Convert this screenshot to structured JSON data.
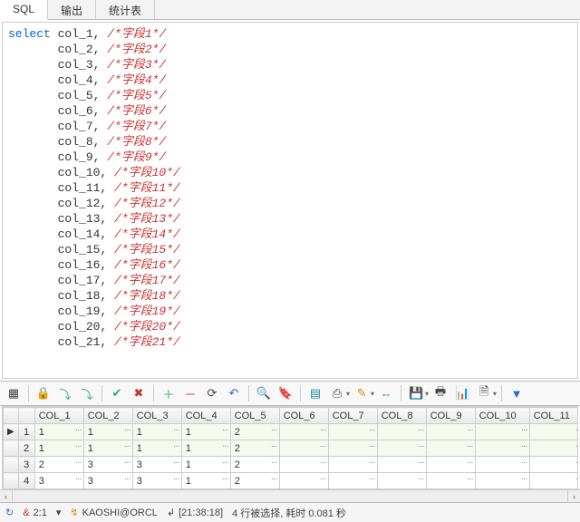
{
  "tabs": {
    "sql": "SQL",
    "output": "输出",
    "stats": "统计表"
  },
  "sql": {
    "keyword": "select",
    "lines": [
      {
        "col": "col_1,",
        "comment": "/*字段1*/"
      },
      {
        "col": "col_2,",
        "comment": "/*字段2*/"
      },
      {
        "col": "col_3,",
        "comment": "/*字段3*/"
      },
      {
        "col": "col_4,",
        "comment": "/*字段4*/"
      },
      {
        "col": "col_5,",
        "comment": "/*字段5*/"
      },
      {
        "col": "col_6,",
        "comment": "/*字段6*/"
      },
      {
        "col": "col_7,",
        "comment": "/*字段7*/"
      },
      {
        "col": "col_8,",
        "comment": "/*字段8*/"
      },
      {
        "col": "col_9,",
        "comment": "/*字段9*/"
      },
      {
        "col": "col_10,",
        "comment": "/*字段10*/"
      },
      {
        "col": "col_11,",
        "comment": "/*字段11*/"
      },
      {
        "col": "col_12,",
        "comment": "/*字段12*/"
      },
      {
        "col": "col_13,",
        "comment": "/*字段13*/"
      },
      {
        "col": "col_14,",
        "comment": "/*字段14*/"
      },
      {
        "col": "col_15,",
        "comment": "/*字段15*/"
      },
      {
        "col": "col_16,",
        "comment": "/*字段16*/"
      },
      {
        "col": "col_17,",
        "comment": "/*字段17*/"
      },
      {
        "col": "col_18,",
        "comment": "/*字段18*/"
      },
      {
        "col": "col_19,",
        "comment": "/*字段19*/"
      },
      {
        "col": "col_20,",
        "comment": "/*字段20*/"
      },
      {
        "col": "col_21,",
        "comment": "/*字段21*/"
      }
    ]
  },
  "toolbar": {
    "grid": "▦",
    "lock": "🔒",
    "fetch1": "⤵",
    "fetch2": "⤵",
    "check": "✔",
    "cancel": "✖",
    "add": "＋",
    "del": "－",
    "dup": "⟳",
    "undo": "↶",
    "find": "🔍",
    "bookmark": "🔖",
    "layout": "▤",
    "col": "⎙",
    "edit": "✎",
    "link": "⇔",
    "save": "💾",
    "print": "🖶",
    "chart": "📊",
    "export": "🗎",
    "filter": "▼"
  },
  "grid": {
    "pointer": "▶",
    "headerblank": "",
    "columns": [
      "COL_1",
      "COL_2",
      "COL_3",
      "COL_4",
      "COL_5",
      "COL_6",
      "COL_7",
      "COL_8",
      "COL_9",
      "COL_10",
      "COL_11"
    ],
    "rows": [
      {
        "n": "1",
        "cells": [
          "1",
          "1",
          "1",
          "1",
          "2",
          "",
          "",
          "",
          "",
          "",
          ""
        ]
      },
      {
        "n": "2",
        "cells": [
          "1",
          "1",
          "1",
          "1",
          "2",
          "",
          "",
          "",
          "",
          "",
          ""
        ]
      },
      {
        "n": "3",
        "cells": [
          "2",
          "3",
          "3",
          "1",
          "2",
          "",
          "",
          "",
          "",
          "",
          ""
        ]
      },
      {
        "n": "4",
        "cells": [
          "3",
          "3",
          "3",
          "1",
          "2",
          "",
          "",
          "",
          "",
          "",
          ""
        ]
      }
    ],
    "dots": "···"
  },
  "scroll": {
    "left": "‹",
    "right": "›"
  },
  "status": {
    "cursor_icon": "↻",
    "amp": "&",
    "pos": "2:1",
    "modified": "▾",
    "conn_icon": "↯",
    "conn": "KAOSHI@ORCL",
    "time_icon": "↲",
    "time": "[21:38:18]",
    "msg": "4 行被选择, 耗时 0.081 秒"
  }
}
